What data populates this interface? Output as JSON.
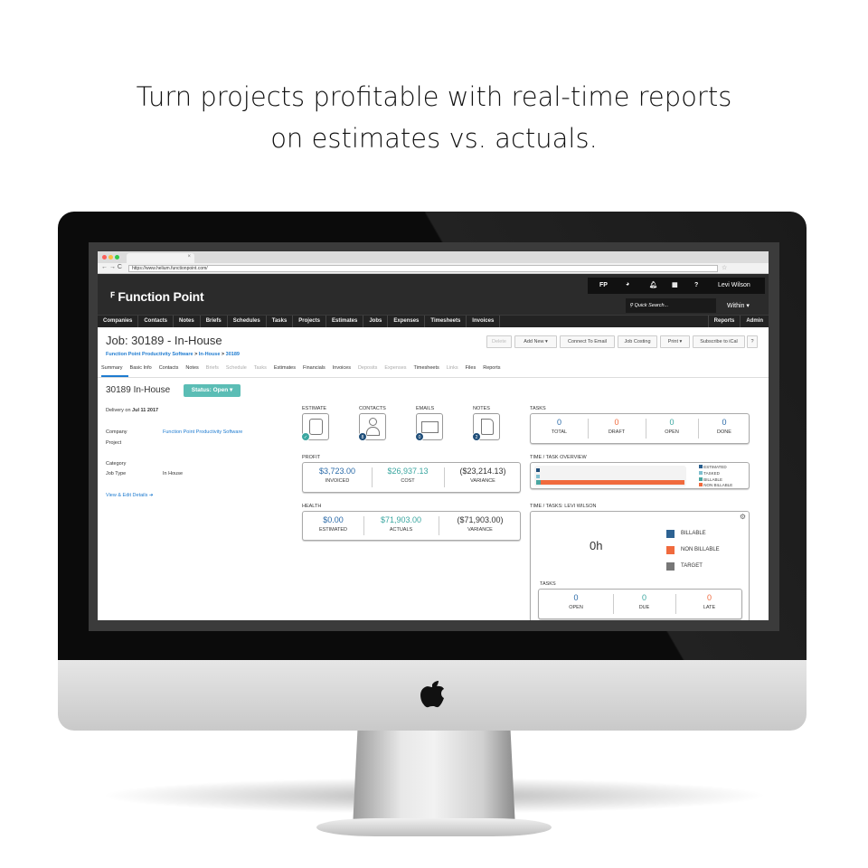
{
  "headline": {
    "line1": "Turn projects profitable with real-time reports",
    "line2": "on estimates vs. actuals."
  },
  "browser": {
    "url": "https://www.helium.functionpoint.com/",
    "tab_close": "×"
  },
  "app": {
    "logo": "Function Point",
    "top": {
      "fp": "FP",
      "help": "?",
      "user": "Levi Wilson",
      "search_placeholder": "Quick Search...",
      "within": "Within ▾"
    },
    "nav": [
      "Companies",
      "Contacts",
      "Notes",
      "Briefs",
      "Schedules",
      "Tasks",
      "Projects",
      "Estimates",
      "Jobs",
      "Expenses",
      "Timesheets",
      "Invoices"
    ],
    "nav_right": [
      "Reports",
      "Admin"
    ],
    "job_title": "Job: 30189 - In-House",
    "breadcrumb": {
      "a": "Function Point Productivity Software",
      "b": "In-House",
      "c": "30189",
      "sep": ">"
    },
    "buttons": {
      "delete": "Delete",
      "add_new": "Add New ▾",
      "connect": "Connect To Email",
      "costing": "Job Costing",
      "print": "Print ▾",
      "subscribe": "Subscribe to iCal",
      "help": "?"
    },
    "tabs": [
      {
        "l": "Summary",
        "d": false
      },
      {
        "l": "Basic Info",
        "d": false
      },
      {
        "l": "Contacts",
        "d": false
      },
      {
        "l": "Notes",
        "d": false
      },
      {
        "l": "Briefs",
        "d": true
      },
      {
        "l": "Schedule",
        "d": true
      },
      {
        "l": "Tasks",
        "d": true
      },
      {
        "l": "Estimates",
        "d": false
      },
      {
        "l": "Financials",
        "d": false
      },
      {
        "l": "Invoices",
        "d": false
      },
      {
        "l": "Deposits",
        "d": true
      },
      {
        "l": "Expenses",
        "d": true
      },
      {
        "l": "Timesheets",
        "d": false
      },
      {
        "l": "Links",
        "d": true
      },
      {
        "l": "Files",
        "d": false
      },
      {
        "l": "Reports",
        "d": false
      }
    ],
    "summary": {
      "heading": "30189 In-House",
      "status": "Status: Open ▾",
      "delivery_label": "Delivery on",
      "delivery_date": "Jul 11 2017",
      "company_label": "Company",
      "company": "Function Point Productivity Software",
      "project_label": "Project",
      "category_label": "Category",
      "jobtype_label": "Job Type",
      "jobtype": "In House",
      "view_edit": "View & Edit Details ➜"
    },
    "icons": [
      {
        "label": "ESTIMATE",
        "badge": "✓"
      },
      {
        "label": "CONTACTS",
        "badge": "8"
      },
      {
        "label": "EMAILS",
        "badge": "0"
      },
      {
        "label": "NOTES",
        "badge": "2"
      }
    ],
    "profit": {
      "label": "PROFIT",
      "invoiced": "$3,723.00",
      "invoiced_k": "INVOICED",
      "cost": "$26,937.13",
      "cost_k": "COST",
      "variance": "($23,214.13)",
      "variance_k": "VARIANCE"
    },
    "health": {
      "label": "HEALTH",
      "estimated": "$0.00",
      "estimated_k": "ESTIMATED",
      "actuals": "$71,903.00",
      "actuals_k": "ACTUALS",
      "variance": "($71,903.00)",
      "variance_k": "VARIANCE"
    },
    "tasks": {
      "label": "TASKS",
      "total": "0",
      "total_k": "TOTAL",
      "draft": "0",
      "draft_k": "DRAFT",
      "open": "0",
      "open_k": "OPEN",
      "done": "0",
      "done_k": "DONE"
    },
    "overview": {
      "label": "TIME / TASK OVERVIEW",
      "legend": [
        "ESTIMATED",
        "TASKED",
        "BILLABLE",
        "NON BILLABLE"
      ]
    },
    "user_time": {
      "label": "TIME / TASKS: LEVI WILSON",
      "hours": "0h",
      "legend": [
        "BILLABLE",
        "NON BILLABLE",
        "TARGET"
      ],
      "tasks_label": "TASKS",
      "open": "0",
      "open_k": "OPEN",
      "due": "0",
      "due_k": "DUE",
      "late": "0",
      "late_k": "LATE"
    }
  },
  "colors": {
    "blue": "#2a6aa8",
    "teal": "#3aa6a0",
    "orange": "#f06a3d",
    "status": "#5bbdb5",
    "header": "#2b2b2b"
  }
}
